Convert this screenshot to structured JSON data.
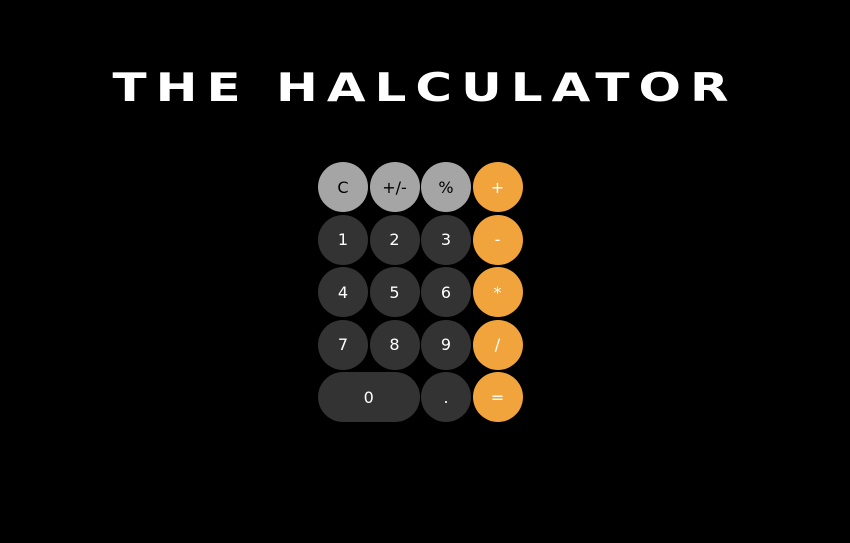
{
  "app": {
    "title": "THE HALCULATOR"
  },
  "colors": {
    "background": "#000000",
    "function_key": "#a5a5a5",
    "number_key": "#333333",
    "operator_key": "#f1a33c"
  },
  "keypad": {
    "clear": "C",
    "negate": "+/-",
    "percent": "%",
    "add": "+",
    "one": "1",
    "two": "2",
    "three": "3",
    "subtract": "-",
    "four": "4",
    "five": "5",
    "six": "6",
    "multiply": "*",
    "seven": "7",
    "eight": "8",
    "nine": "9",
    "divide": "/",
    "zero": "0",
    "decimal": ".",
    "equals": "="
  }
}
